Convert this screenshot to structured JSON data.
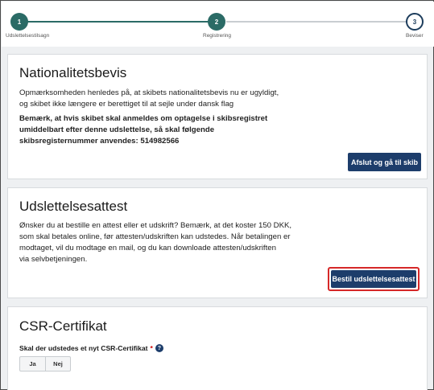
{
  "stepper": {
    "steps": [
      {
        "number": "1",
        "label": "Udslettelsestilsagn",
        "state": "done"
      },
      {
        "number": "2",
        "label": "Registrering",
        "state": "done"
      },
      {
        "number": "3",
        "label": "Beviser",
        "state": "current"
      }
    ],
    "colors": {
      "done": "#2b6b66",
      "current": "#1d3d5c"
    }
  },
  "nationality": {
    "title": "Nationalitetsbevis",
    "line1": "Opmærksomheden henledes på, at skibets nationalitetsbevis nu er ugyldigt,",
    "line2": "og skibet ikke længere er berettiget til at sejle under dansk flag",
    "bold1": "Bemærk, at hvis skibet skal anmeldes om optagelse i skibsregistret",
    "bold2": "umiddelbart efter denne udslettelse, så skal følgende",
    "bold3": "skibsregisternummer anvendes: 514982566",
    "button": "Afslut og gå til skib"
  },
  "attest": {
    "title": "Udslettelsesattest",
    "line1": "Ønsker du at bestille en attest eller et udskrift? Bemærk, at det koster 150 DKK,",
    "line2": "som skal betales online, før attesten/udskriften kan udstedes. Når betalingen er",
    "line3": "modtaget, vil du modtage en mail, og du kan downloade attesten/udskriften",
    "line4": "via selvbetjeningen.",
    "button": "Bestil udslettelsesattest"
  },
  "csr": {
    "title": "CSR-Certifikat",
    "question": "Skal der udstedes et nyt CSR-Certifikat",
    "required_mark": "*",
    "help_icon": "question-circle-icon",
    "options": [
      "Ja",
      "Nej"
    ]
  },
  "colors": {
    "button": "#1d3d6b",
    "highlight": "#d62828"
  }
}
